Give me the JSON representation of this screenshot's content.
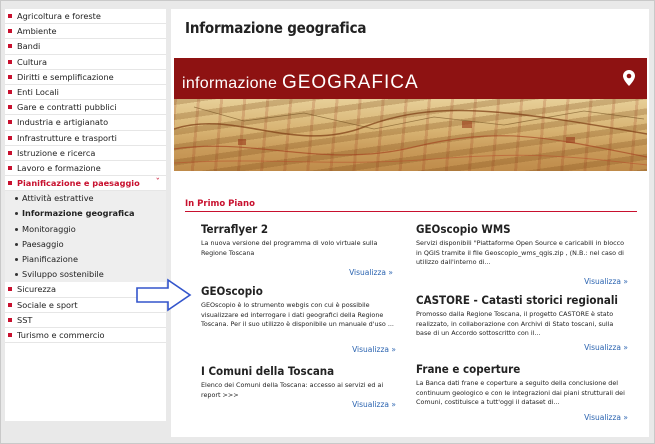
{
  "sidebar": {
    "items_top": [
      "Agricoltura e foreste",
      "Ambiente",
      "Bandi",
      "Cultura",
      "Diritti e semplificazione",
      "Enti Locali",
      "Gare e contratti pubblici",
      "Industria e artigianato",
      "Infrastrutture e trasporti",
      "Istruzione e ricerca",
      "Lavoro e formazione"
    ],
    "active_item": "Pianificazione e paesaggio",
    "active_chevron": "ˇ",
    "subitems": [
      "Attività estrattive",
      "Informazione geografica",
      "Monitoraggio",
      "Paesaggio",
      "Pianificazione",
      "Sviluppo sostenibile"
    ],
    "items_bottom": [
      "Sicurezza",
      "Sociale e sport",
      "SST",
      "Turismo e commercio"
    ]
  },
  "main": {
    "title": "Informazione geografica",
    "banner": {
      "text_small": "informazione ",
      "text_big": "GEOGRAFICA"
    },
    "section_title": "In Primo Piano",
    "more_label": "Visualizza »",
    "cards": [
      {
        "title": "Terraflyer 2",
        "desc": "La nuova versione del programma di volo virtuale sulla Regione Toscana"
      },
      {
        "title": "GEOscopio WMS",
        "desc": "Servizi disponibili \"Piattaforme Open Source e caricabili in blocco in QGIS tramite il file Geoscopio_wms_qgis.zip , (N.B.: nel caso di utilizzo dall'interno di..."
      },
      {
        "title": "GEOscopio",
        "desc": "GEOscopio è lo strumento webgis con cui è possibile visualizzare ed interrogare i dati geografici della Regione Toscana. Per il suo utilizzo è disponibile un manuale d'uso ..."
      },
      {
        "title": "CASTORE - Catasti storici regionali",
        "desc": "Promosso dalla Regione Toscana, il progetto CASTORE è stato realizzato, in collaborazione con Archivi di Stato toscani, sulla base di un Accordo sottoscritto con il..."
      },
      {
        "title": "I Comuni della Toscana",
        "desc": "Elenco dei Comuni della Toscana: accesso ai servizi ed ai report >>>"
      },
      {
        "title": "Frane e coperture",
        "desc": "La Banca dati frane e coperture a seguito della conclusione del continuum geologico e con le integrazioni dai piani strutturali dei Comuni, costituisce a tutt'oggi il dataset di..."
      }
    ]
  },
  "colors": {
    "accent": "#c8102e",
    "banner": "#8e1212",
    "link": "#2a63b0"
  },
  "icons": [
    "bullet-icon",
    "chevron-down-icon",
    "map-pin-icon",
    "arrow-right-icon"
  ]
}
